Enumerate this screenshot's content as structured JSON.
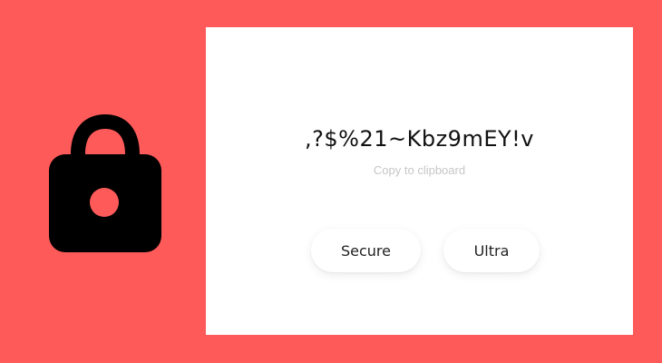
{
  "icon": "lock-icon",
  "colors": {
    "background": "#ff5a5a",
    "card": "#ffffff",
    "text": "#111111",
    "muted": "#c6c6c6"
  },
  "password": ",?$%21~Kbz9mEY!v",
  "copy_label": "Copy to clipboard",
  "buttons": {
    "secure_label": "Secure",
    "ultra_label": "Ultra"
  }
}
